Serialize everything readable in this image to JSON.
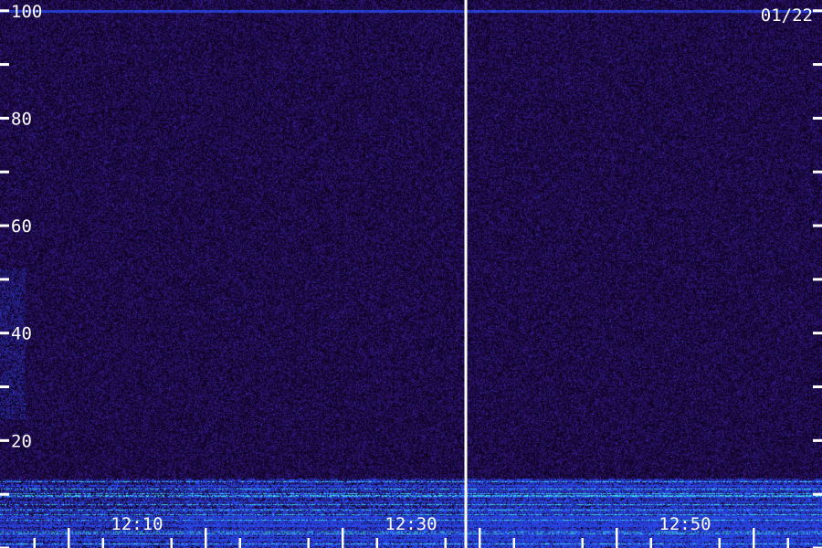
{
  "chart_data": {
    "type": "heatmap",
    "date_label": "01/22",
    "y_axis": {
      "range": [
        0,
        102
      ],
      "ticks": [
        0,
        10,
        20,
        30,
        40,
        50,
        60,
        70,
        80,
        90,
        100
      ],
      "labels": [
        "20",
        "40",
        "60",
        "80",
        "100"
      ],
      "label_values": [
        20,
        40,
        60,
        80,
        100
      ]
    },
    "x_axis": {
      "range": [
        "12:00",
        "13:00"
      ],
      "labels": [
        "12:10",
        "12:30",
        "12:50"
      ],
      "label_minutes": [
        10,
        30,
        50
      ],
      "minor_tick_minutes": [
        2.5,
        7.5,
        12.5,
        17.5,
        22.5,
        27.5,
        32.5,
        37.5,
        42.5,
        47.5,
        52.5,
        57.5
      ]
    },
    "time_marker": "12:34",
    "features": {
      "horizontal_line_value": 100,
      "low_band_range": [
        0,
        13
      ],
      "vertical_streak_minutes": 0.8,
      "vertical_streak_range": [
        24,
        52
      ]
    },
    "colors": {
      "background_low": "#0a0018",
      "background_mid": "#3a1a90",
      "band_blue": "#2a50ff",
      "band_cyan": "#40ffe0",
      "marker": "#ffffff"
    }
  }
}
